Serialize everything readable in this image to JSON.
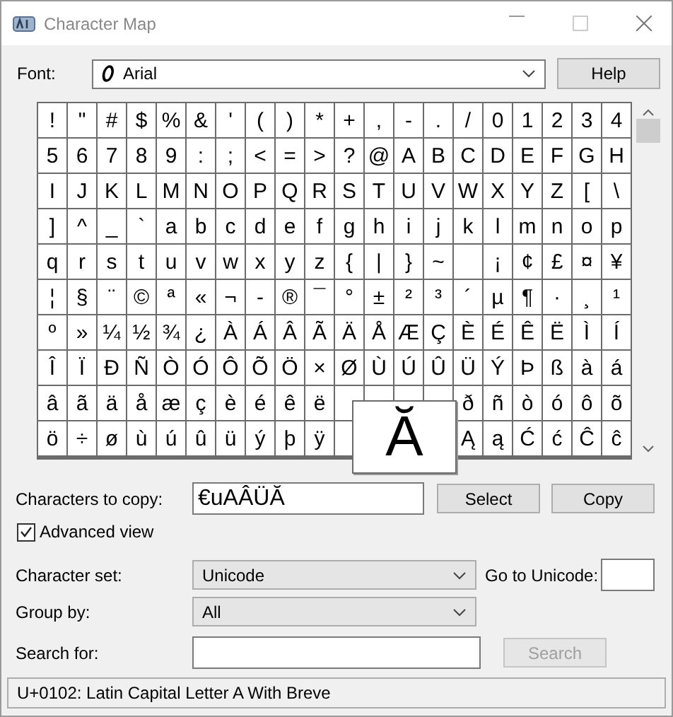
{
  "window": {
    "title": "Character Map"
  },
  "font": {
    "label": "Font:",
    "value": "Arial"
  },
  "help_button": "Help",
  "grid": {
    "rows": [
      [
        "!",
        "\"",
        "#",
        "$",
        "%",
        "&",
        "'",
        "(",
        ")",
        "*",
        "+",
        ",",
        "-",
        ".",
        "/",
        "0",
        "1",
        "2",
        "3",
        "4"
      ],
      [
        "5",
        "6",
        "7",
        "8",
        "9",
        ":",
        ";",
        "<",
        "=",
        ">",
        "?",
        "@",
        "A",
        "B",
        "C",
        "D",
        "E",
        "F",
        "G",
        "H"
      ],
      [
        "I",
        "J",
        "K",
        "L",
        "M",
        "N",
        "O",
        "P",
        "Q",
        "R",
        "S",
        "T",
        "U",
        "V",
        "W",
        "X",
        "Y",
        "Z",
        "[",
        "\\"
      ],
      [
        "]",
        "^",
        "_",
        "`",
        "a",
        "b",
        "c",
        "d",
        "e",
        "f",
        "g",
        "h",
        "i",
        "j",
        "k",
        "l",
        "m",
        "n",
        "o",
        "p"
      ],
      [
        "q",
        "r",
        "s",
        "t",
        "u",
        "v",
        "w",
        "x",
        "y",
        "z",
        "{",
        "|",
        "}",
        "~",
        null,
        "¡",
        "¢",
        "£",
        "¤",
        "¥"
      ],
      [
        "¦",
        "§",
        "¨",
        "©",
        "ª",
        "«",
        "¬",
        "-",
        "®",
        "¯",
        "°",
        "±",
        "²",
        "³",
        "´",
        "µ",
        "¶",
        "·",
        "¸",
        "¹"
      ],
      [
        "º",
        "»",
        "¼",
        "½",
        "¾",
        "¿",
        "À",
        "Á",
        "Â",
        "Ã",
        "Ä",
        "Å",
        "Æ",
        "Ç",
        "È",
        "É",
        "Ê",
        "Ë",
        "Ì",
        "Í"
      ],
      [
        "Î",
        "Ï",
        "Ð",
        "Ñ",
        "Ò",
        "Ó",
        "Ô",
        "Õ",
        "Ö",
        "×",
        "Ø",
        "Ù",
        "Ú",
        "Û",
        "Ü",
        "Ý",
        "Þ",
        "ß",
        "à",
        "á"
      ],
      [
        "â",
        "ã",
        "ä",
        "å",
        "æ",
        "ç",
        "è",
        "é",
        "ê",
        "ë",
        null,
        null,
        null,
        null,
        "ð",
        "ñ",
        "ò",
        "ó",
        "ô",
        "õ"
      ],
      [
        "ö",
        "÷",
        "ø",
        "ù",
        "ú",
        "û",
        "ü",
        "ý",
        "þ",
        "ÿ",
        null,
        null,
        null,
        null,
        "Ą",
        "ą",
        "Ć",
        "ć",
        "Ĉ",
        "ĉ"
      ]
    ],
    "magnified": "Ă"
  },
  "copy": {
    "label": "Characters to copy:",
    "value": "€uAÂÜĂ",
    "select_button": "Select",
    "copy_button": "Copy"
  },
  "advanced_view": {
    "label": "Advanced view",
    "checked": true
  },
  "character_set": {
    "label": "Character set:",
    "value": "Unicode"
  },
  "go_to_unicode": {
    "label": "Go to Unicode:"
  },
  "group_by": {
    "label": "Group by:",
    "value": "All"
  },
  "search": {
    "label": "Search for:",
    "button": "Search",
    "disabled": true
  },
  "status_bar": "U+0102: Latin Capital Letter A With Breve"
}
